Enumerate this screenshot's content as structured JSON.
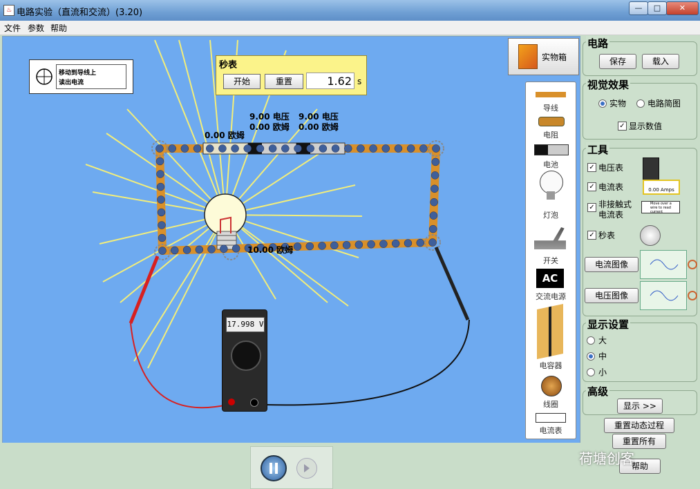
{
  "window": {
    "title": "电路实验（直流和交流）(3.20)",
    "minimize": "—",
    "maximize": "□",
    "close": "✕"
  },
  "menu": [
    "文件",
    "参数",
    "帮助"
  ],
  "nc_ammeter": {
    "line1": "移动到导线上",
    "line2": "读出电流"
  },
  "stopwatch": {
    "title": "秒表",
    "start": "开始",
    "reset": "重置",
    "time": "1.62",
    "unit": "s"
  },
  "kit_button": "实物箱",
  "circuit_labels": {
    "resistor1": "0.00 欧姆",
    "battery1_v": "9.00 电压",
    "battery1_r": "0.00 欧姆",
    "battery2_v": "9.00 电压",
    "battery2_r": "0.00 欧姆",
    "bulb": "10.00 欧姆"
  },
  "multimeter": {
    "reading": "17.998 V"
  },
  "toolbox": [
    "导线",
    "电阻",
    "电池",
    "灯泡",
    "开关",
    "交流电源",
    "电容器",
    "线圈",
    "电流表"
  ],
  "panel": {
    "circuit": {
      "title": "电路",
      "save": "保存",
      "load": "载入"
    },
    "visual": {
      "title": "视觉效果",
      "opt_real": "实物",
      "opt_schematic": "电路简图",
      "show_values": "显示数值"
    },
    "tools": {
      "title": "工具",
      "voltmeter": "电压表",
      "ammeter": "电流表",
      "ammeter_display": "0.00 Amps",
      "noncontact_1": "非接触式",
      "noncontact_2": "电流表",
      "noncontact_hint": "Move over a wire to read current",
      "stopwatch": "秒表",
      "current_chart": "电流图像",
      "voltage_chart": "电压图像"
    },
    "display": {
      "title": "显示设置",
      "large": "大",
      "medium": "中",
      "small": "小"
    },
    "advanced": {
      "title": "高级",
      "show": "显示 >>"
    },
    "reset_dynamics": "重置动态过程",
    "reset_all": "重置所有",
    "help": "帮助"
  },
  "watermark": "荷塘创客",
  "accent": {
    "wire": "#d9902a",
    "canvas": "#6eaaf0",
    "panel": "#c9ddc9",
    "stopwatch": "#fbf38a"
  }
}
